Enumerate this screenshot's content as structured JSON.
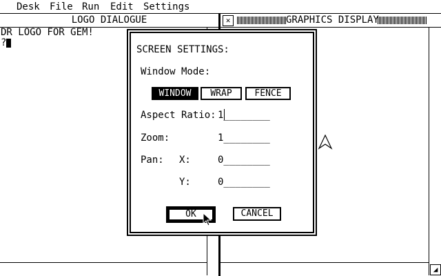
{
  "menubar": {
    "items": [
      "Desk",
      "File",
      "Run",
      "Edit",
      "Settings"
    ]
  },
  "logo_window": {
    "title": "LOGO DIALOGUE",
    "lines": [
      "DR LOGO FOR GEM!",
      "?"
    ]
  },
  "graphics_window": {
    "title": "GRAPHICS DISPLAY",
    "close_glyph": "✕",
    "resize_glyph": "◢"
  },
  "dialog": {
    "title": "SCREEN SETTINGS:",
    "window_mode_label": "Window Mode:",
    "modes": [
      "WINDOW",
      "WRAP",
      "FENCE"
    ],
    "selected_mode": "WINDOW",
    "aspect_label": "Aspect Ratio:",
    "aspect_value": "1________",
    "zoom_label": "Zoom:",
    "zoom_value": "1________",
    "pan_label": "Pan:",
    "pan_x_label": "X:",
    "pan_x_value": "0________",
    "pan_y_label": "Y:",
    "pan_y_value": "0________",
    "ok_label": "OK",
    "cancel_label": "CANCEL"
  }
}
